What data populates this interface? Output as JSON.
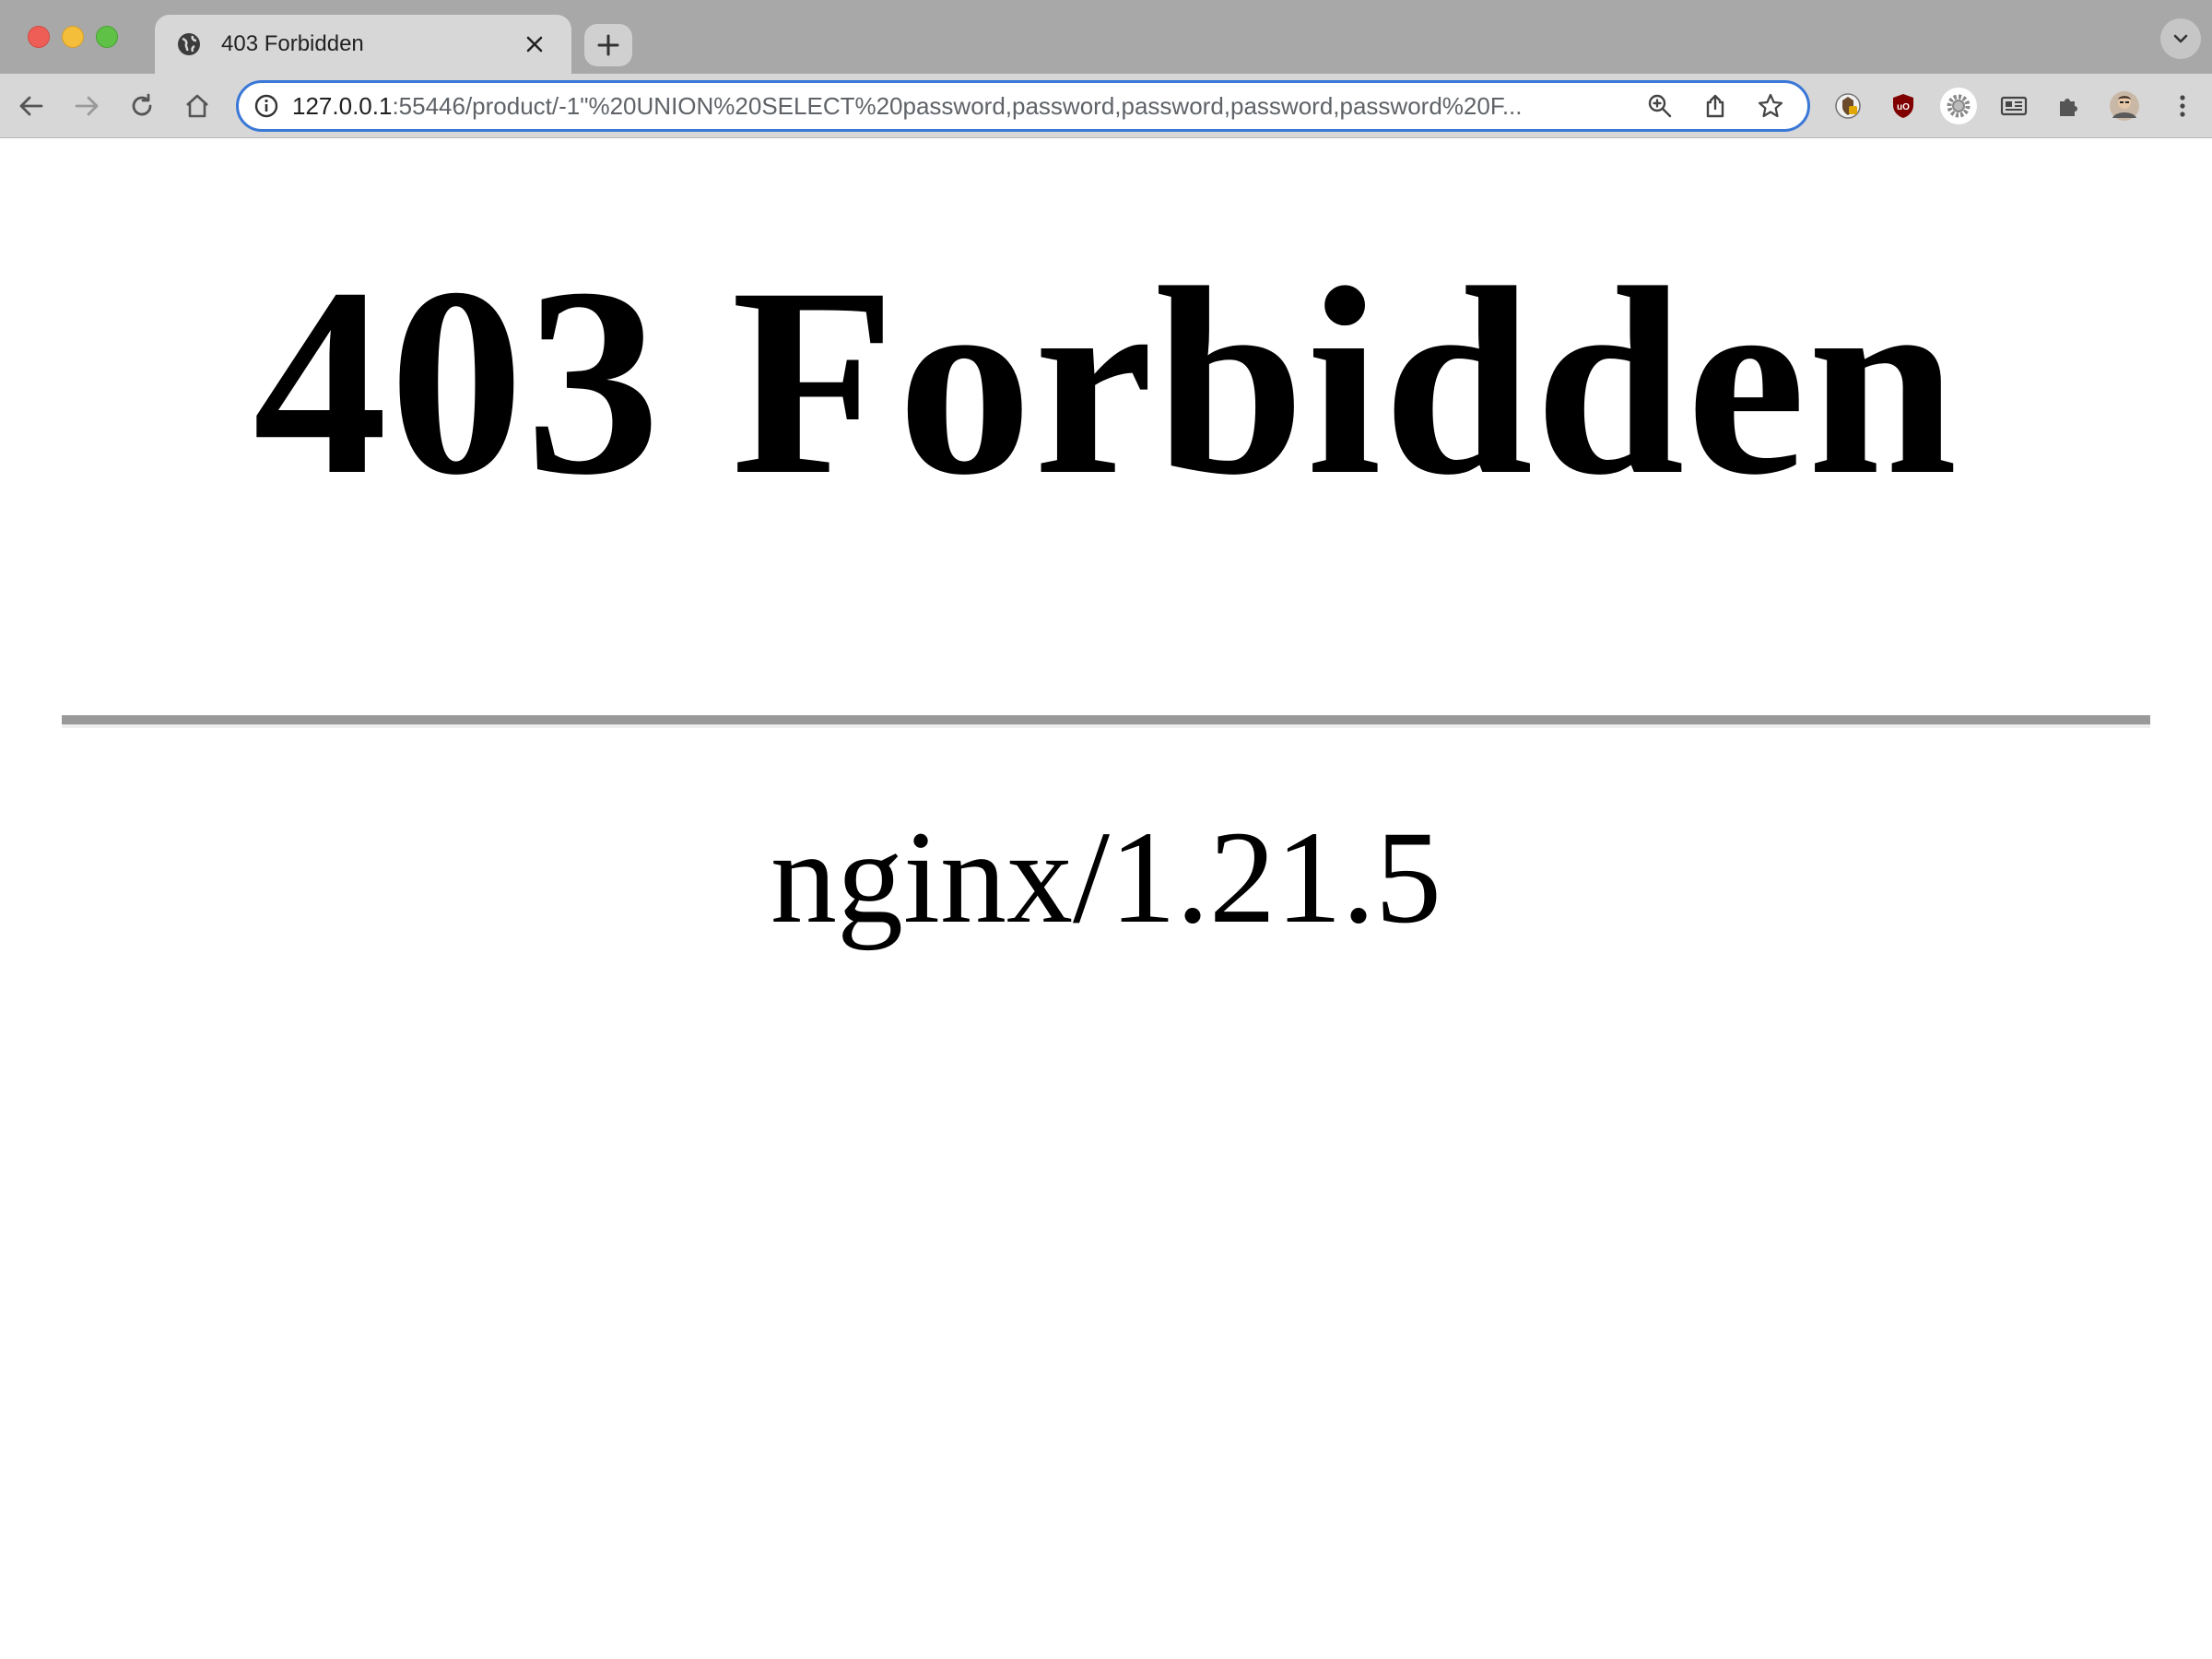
{
  "browser": {
    "tab": {
      "title": "403 Forbidden",
      "favicon": "globe-icon"
    },
    "address_bar": {
      "host": "127.0.0.1",
      "path": ":55446/product/-1\"%20UNION%20SELECT%20password,password,password,password,password%20F..."
    },
    "colors": {
      "tabbar_bg": "#a8a8a8",
      "toolbar_bg": "#d7d7d7",
      "focus_ring": "#3a78d8"
    }
  },
  "page": {
    "heading": "403 Forbidden",
    "server_signature": "nginx/1.21.5"
  }
}
